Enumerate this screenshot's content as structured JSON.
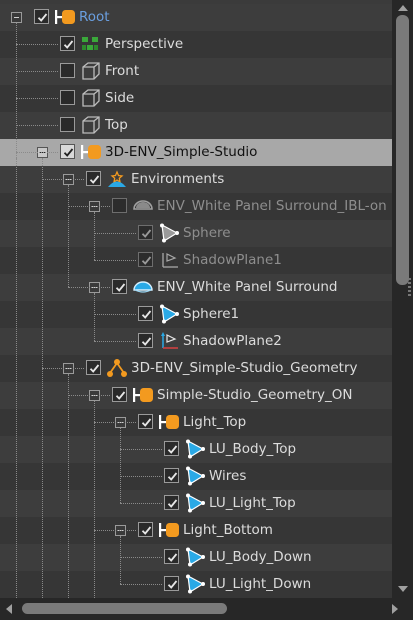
{
  "tree": {
    "rows": [
      {
        "label": "Root",
        "level": 0,
        "toggle": true,
        "checked": true,
        "dim": false,
        "icon": "null-orange-icon",
        "style": "root"
      },
      {
        "label": "Perspective",
        "level": 1,
        "toggle": false,
        "checked": true,
        "dim": false,
        "icon": "perspective-camera-green-icon"
      },
      {
        "label": "Front",
        "level": 1,
        "toggle": false,
        "checked": false,
        "dim": false,
        "icon": "camera-cube-icon"
      },
      {
        "label": "Side",
        "level": 1,
        "toggle": false,
        "checked": false,
        "dim": false,
        "icon": "camera-cube-icon"
      },
      {
        "label": "Top",
        "level": 1,
        "toggle": false,
        "checked": false,
        "dim": false,
        "icon": "camera-cube-icon"
      },
      {
        "label": "3D-ENV_Simple-Studio",
        "level": 1,
        "toggle": true,
        "checked": true,
        "dim": false,
        "icon": "null-orange-icon",
        "selected": true
      },
      {
        "label": "Environments",
        "level": 2,
        "toggle": true,
        "checked": true,
        "dim": false,
        "icon": "environments-group-icon"
      },
      {
        "label": "ENV_White Panel Surround_IBL-on",
        "level": 3,
        "toggle": true,
        "checked": false,
        "dim": true,
        "icon": "environment-dome-grey-icon"
      },
      {
        "label": "Sphere",
        "level": 4,
        "toggle": false,
        "checked": true,
        "dim": true,
        "icon": "polygon-object-grey-icon"
      },
      {
        "label": "ShadowPlane1",
        "level": 4,
        "toggle": false,
        "checked": true,
        "dim": true,
        "icon": "shadow-plane-grey-icon"
      },
      {
        "label": "ENV_White Panel Surround",
        "level": 3,
        "toggle": true,
        "checked": true,
        "dim": false,
        "icon": "environment-dome-blue-icon"
      },
      {
        "label": "Sphere1",
        "level": 4,
        "toggle": false,
        "checked": true,
        "dim": false,
        "icon": "polygon-object-blue-icon"
      },
      {
        "label": "ShadowPlane2",
        "level": 4,
        "toggle": false,
        "checked": true,
        "dim": false,
        "icon": "shadow-plane-icon"
      },
      {
        "label": "3D-ENV_Simple-Studio_Geometry",
        "level": 2,
        "toggle": true,
        "checked": true,
        "dim": false,
        "icon": "group-orange-icon"
      },
      {
        "label": "Simple-Studio_Geometry_ON",
        "level": 3,
        "toggle": true,
        "checked": true,
        "dim": false,
        "icon": "null-orange-icon"
      },
      {
        "label": "Light_Top",
        "level": 4,
        "toggle": true,
        "checked": true,
        "dim": false,
        "icon": "null-orange-icon"
      },
      {
        "label": "LU_Body_Top",
        "level": 5,
        "toggle": false,
        "checked": true,
        "dim": false,
        "icon": "polygon-object-blue-icon"
      },
      {
        "label": "Wires",
        "level": 5,
        "toggle": false,
        "checked": true,
        "dim": false,
        "icon": "polygon-object-blue-icon"
      },
      {
        "label": "LU_Light_Top",
        "level": 5,
        "toggle": false,
        "checked": true,
        "dim": false,
        "icon": "polygon-object-blue-icon"
      },
      {
        "label": "Light_Bottom",
        "level": 4,
        "toggle": true,
        "checked": true,
        "dim": false,
        "icon": "null-orange-icon"
      },
      {
        "label": "LU_Body_Down",
        "level": 5,
        "toggle": false,
        "checked": true,
        "dim": false,
        "icon": "polygon-object-blue-icon"
      },
      {
        "label": "LU_Light_Down",
        "level": 5,
        "toggle": false,
        "checked": true,
        "dim": false,
        "icon": "polygon-object-blue-icon"
      }
    ]
  },
  "colors": {
    "selected_row": "#a8a8a8",
    "root_label": "#6a9fe0",
    "null_orange": "#f39a1f",
    "object_blue": "#2aa9e6",
    "camera_green": "#3aa83a"
  },
  "scroll": {
    "vertical_position": 0.0,
    "horizontal_position": 0.0
  }
}
